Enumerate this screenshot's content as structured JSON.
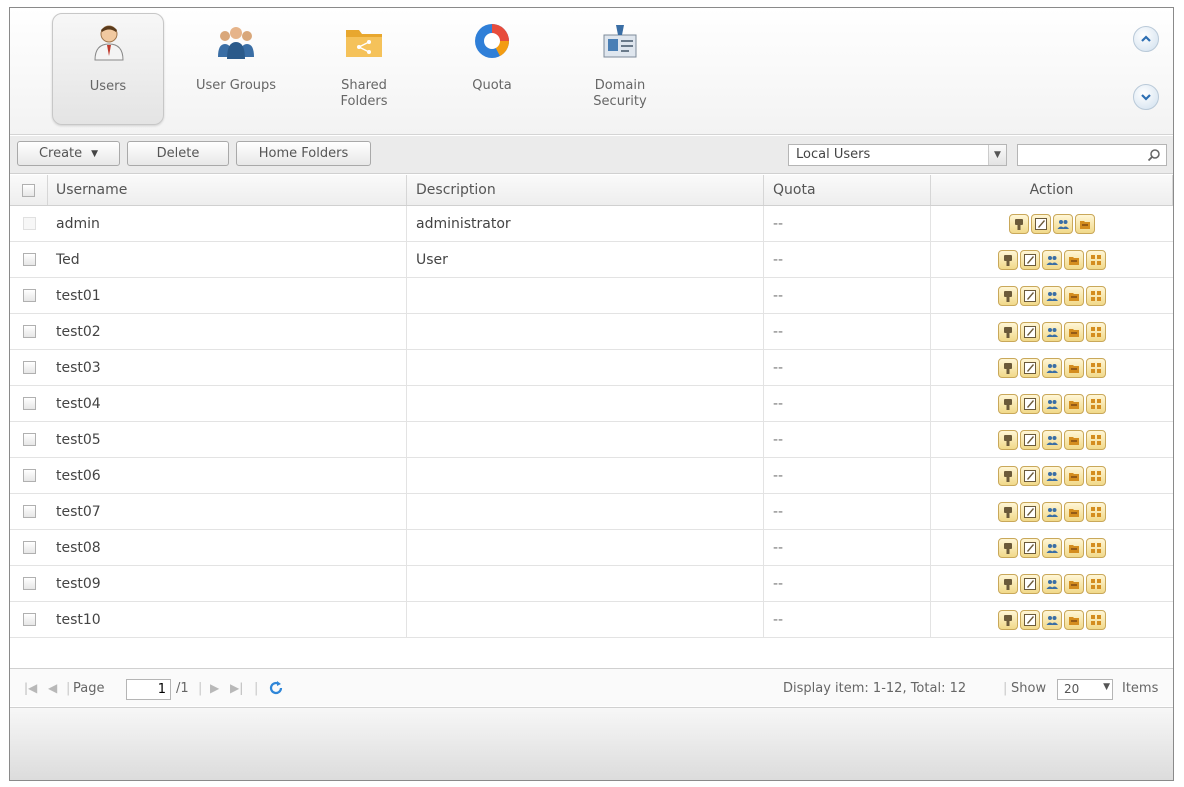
{
  "nav": {
    "items": [
      {
        "label": "Users",
        "icon": "user-icon",
        "active": true
      },
      {
        "label": "User Groups",
        "icon": "user-groups-icon",
        "active": false
      },
      {
        "label": "Shared\nFolders",
        "icon": "shared-folder-icon",
        "active": false
      },
      {
        "label": "Quota",
        "icon": "quota-pie-icon",
        "active": false
      },
      {
        "label": "Domain\nSecurity",
        "icon": "domain-security-icon",
        "active": false
      }
    ]
  },
  "toolbar": {
    "create_label": "Create",
    "delete_label": "Delete",
    "home_folders_label": "Home Folders",
    "filter_value": "Local Users",
    "search_value": ""
  },
  "grid": {
    "columns": [
      "Username",
      "Description",
      "Quota",
      "Action"
    ],
    "rows": [
      {
        "username": "admin",
        "description": "administrator",
        "quota": "--",
        "actions": [
          "change-password-icon",
          "edit-profile-icon",
          "edit-group-icon",
          "edit-shared-folder-icon"
        ],
        "selectable": false
      },
      {
        "username": "Ted",
        "description": "User",
        "quota": "--",
        "actions": [
          "change-password-icon",
          "edit-profile-icon",
          "edit-group-icon",
          "edit-shared-folder-icon",
          "application-privilege-icon"
        ],
        "selectable": true
      },
      {
        "username": "test01",
        "description": "",
        "quota": "--",
        "actions": [
          "change-password-icon",
          "edit-profile-icon",
          "edit-group-icon",
          "edit-shared-folder-icon",
          "application-privilege-icon"
        ],
        "selectable": true
      },
      {
        "username": "test02",
        "description": "",
        "quota": "--",
        "actions": [
          "change-password-icon",
          "edit-profile-icon",
          "edit-group-icon",
          "edit-shared-folder-icon",
          "application-privilege-icon"
        ],
        "selectable": true
      },
      {
        "username": "test03",
        "description": "",
        "quota": "--",
        "actions": [
          "change-password-icon",
          "edit-profile-icon",
          "edit-group-icon",
          "edit-shared-folder-icon",
          "application-privilege-icon"
        ],
        "selectable": true
      },
      {
        "username": "test04",
        "description": "",
        "quota": "--",
        "actions": [
          "change-password-icon",
          "edit-profile-icon",
          "edit-group-icon",
          "edit-shared-folder-icon",
          "application-privilege-icon"
        ],
        "selectable": true
      },
      {
        "username": "test05",
        "description": "",
        "quota": "--",
        "actions": [
          "change-password-icon",
          "edit-profile-icon",
          "edit-group-icon",
          "edit-shared-folder-icon",
          "application-privilege-icon"
        ],
        "selectable": true
      },
      {
        "username": "test06",
        "description": "",
        "quota": "--",
        "actions": [
          "change-password-icon",
          "edit-profile-icon",
          "edit-group-icon",
          "edit-shared-folder-icon",
          "application-privilege-icon"
        ],
        "selectable": true
      },
      {
        "username": "test07",
        "description": "",
        "quota": "--",
        "actions": [
          "change-password-icon",
          "edit-profile-icon",
          "edit-group-icon",
          "edit-shared-folder-icon",
          "application-privilege-icon"
        ],
        "selectable": true
      },
      {
        "username": "test08",
        "description": "",
        "quota": "--",
        "actions": [
          "change-password-icon",
          "edit-profile-icon",
          "edit-group-icon",
          "edit-shared-folder-icon",
          "application-privilege-icon"
        ],
        "selectable": true
      },
      {
        "username": "test09",
        "description": "",
        "quota": "--",
        "actions": [
          "change-password-icon",
          "edit-profile-icon",
          "edit-group-icon",
          "edit-shared-folder-icon",
          "application-privilege-icon"
        ],
        "selectable": true
      },
      {
        "username": "test10",
        "description": "",
        "quota": "--",
        "actions": [
          "change-password-icon",
          "edit-profile-icon",
          "edit-group-icon",
          "edit-shared-folder-icon",
          "application-privilege-icon"
        ],
        "selectable": true
      }
    ]
  },
  "pager": {
    "page_label": "Page",
    "page_value": "1",
    "page_total": "/1",
    "display_text": "Display item: 1-12, Total: 12",
    "show_label": "Show",
    "show_value": "20",
    "items_label": "Items"
  },
  "colors": {
    "accent_orange": "#f1d98a",
    "nav_blue": "#2d6fb3"
  }
}
